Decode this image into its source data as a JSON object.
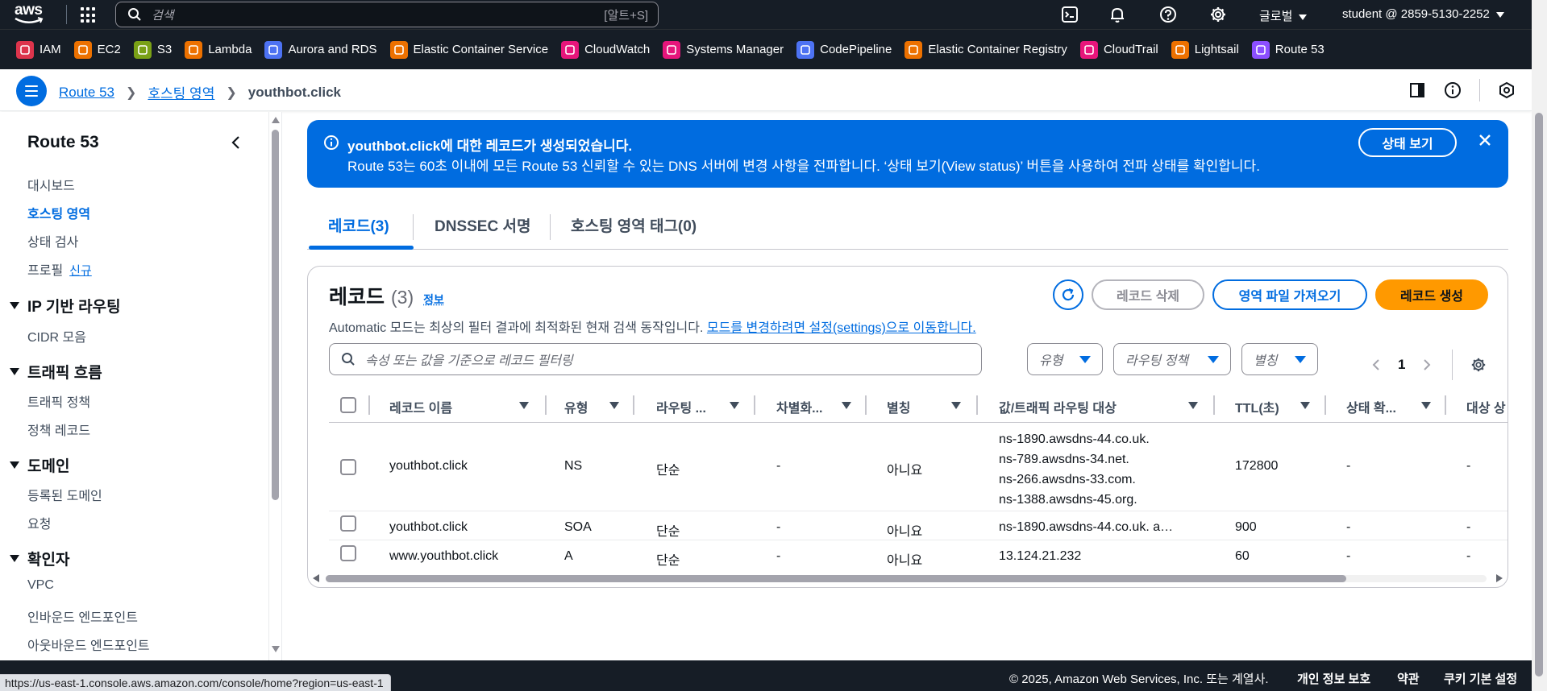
{
  "topnav": {
    "logo_text": "aws",
    "search_placeholder": "검색",
    "search_shortcut": "[알트+S]",
    "region_label": "글로벌",
    "account_label": "student @ 2859-5130-2252"
  },
  "favorites": [
    {
      "label": "IAM",
      "color": "#dd344c",
      "icon": "iam-icon"
    },
    {
      "label": "EC2",
      "color": "#ed7100",
      "icon": "ec2-icon"
    },
    {
      "label": "S3",
      "color": "#7aa116",
      "icon": "s3-icon"
    },
    {
      "label": "Lambda",
      "color": "#ed7100",
      "icon": "lambda-icon"
    },
    {
      "label": "Aurora and RDS",
      "color": "#4d72f3",
      "icon": "rds-icon"
    },
    {
      "label": "Elastic Container Service",
      "color": "#ed7100",
      "icon": "ecs-icon"
    },
    {
      "label": "CloudWatch",
      "color": "#e7157b",
      "icon": "cloudwatch-icon"
    },
    {
      "label": "Systems Manager",
      "color": "#e7157b",
      "icon": "systems-manager-icon"
    },
    {
      "label": "CodePipeline",
      "color": "#4d72f3",
      "icon": "codepipeline-icon"
    },
    {
      "label": "Elastic Container Registry",
      "color": "#ed7100",
      "icon": "ecr-icon"
    },
    {
      "label": "CloudTrail",
      "color": "#e7157b",
      "icon": "cloudtrail-icon"
    },
    {
      "label": "Lightsail",
      "color": "#ed7100",
      "icon": "lightsail-icon"
    },
    {
      "label": "Route 53",
      "color": "#8c4fff",
      "icon": "route53-icon"
    }
  ],
  "breadcrumb": {
    "items": [
      "Route 53",
      "호스팅 영역"
    ],
    "current": "youthbot.click"
  },
  "sidebar": {
    "title": "Route 53",
    "items": [
      "대시보드",
      "호스팅 영역",
      "상태 검사",
      "프로필"
    ],
    "new_badge": "신규",
    "groups": [
      {
        "title": "IP 기반 라우팅",
        "items": [
          "CIDR 모음"
        ]
      },
      {
        "title": "트래픽 흐름",
        "items": [
          "트래픽 정책",
          "정책 레코드"
        ]
      },
      {
        "title": "도메인",
        "items": [
          "등록된 도메인",
          "요청"
        ]
      },
      {
        "title": "확인자",
        "items": [
          "VPC",
          "인바운드 엔드포인트",
          "아웃바운드 엔드포인트"
        ]
      }
    ]
  },
  "flash": {
    "title": "youthbot.click에 대한 레코드가 생성되었습니다.",
    "message": "Route 53는 60초 이내에 모든 Route 53 신뢰할 수 있는 DNS 서버에 변경 사항을 전파합니다. ‘상태 보기(View status)’ 버튼을 사용하여 전파 상태를 확인합니다.",
    "button": "상태 보기"
  },
  "tabs": [
    "레코드(3)",
    "DNSSEC 서명",
    "호스팅 영역 태그(0)"
  ],
  "records": {
    "title": "레코드",
    "count": "(3)",
    "info": "정보",
    "description": "Automatic 모드는 최상의 필터 결과에 최적화된 현재 검색 동작입니다.",
    "description_link": "모드를 변경하려면 설정(settings)으로 이동합니다.",
    "delete_button": "레코드 삭제",
    "import_button": "영역 파일 가져오기",
    "create_button": "레코드 생성",
    "filter_placeholder": "속성 또는 값을 기준으로 레코드 필터링",
    "filters": [
      "유형",
      "라우팅 정책",
      "별칭"
    ],
    "page": "1",
    "columns": [
      "레코드 이름",
      "유형",
      "라우팅 ...",
      "차별화...",
      "별칭",
      "값/트래픽 라우팅 대상",
      "TTL(초)",
      "상태 확...",
      "대상 상"
    ],
    "rows": [
      {
        "name": "youthbot.click",
        "type": "NS",
        "routing": "단순",
        "diff": "-",
        "alias": "아니요",
        "values": [
          "ns-1890.awsdns-44.co.uk.",
          "ns-789.awsdns-34.net.",
          "ns-266.awsdns-33.com.",
          "ns-1388.awsdns-45.org."
        ],
        "ttl": "172800",
        "health": "-",
        "target": "-"
      },
      {
        "name": "youthbot.click",
        "type": "SOA",
        "routing": "단순",
        "diff": "-",
        "alias": "아니요",
        "values": [
          "ns-1890.awsdns-44.co.uk. a…"
        ],
        "ttl": "900",
        "health": "-",
        "target": "-"
      },
      {
        "name": "www.youthbot.click",
        "type": "A",
        "routing": "단순",
        "diff": "-",
        "alias": "아니요",
        "values": [
          "13.124.21.232"
        ],
        "ttl": "60",
        "health": "-",
        "target": "-"
      }
    ]
  },
  "footer": {
    "copyright": "© 2025, Amazon Web Services, Inc. 또는 계열사.",
    "links": [
      "개인 정보 보호",
      "약관",
      "쿠키 기본 설정"
    ]
  },
  "status_url": "https://us-east-1.console.aws.amazon.com/console/home?region=us-east-1"
}
